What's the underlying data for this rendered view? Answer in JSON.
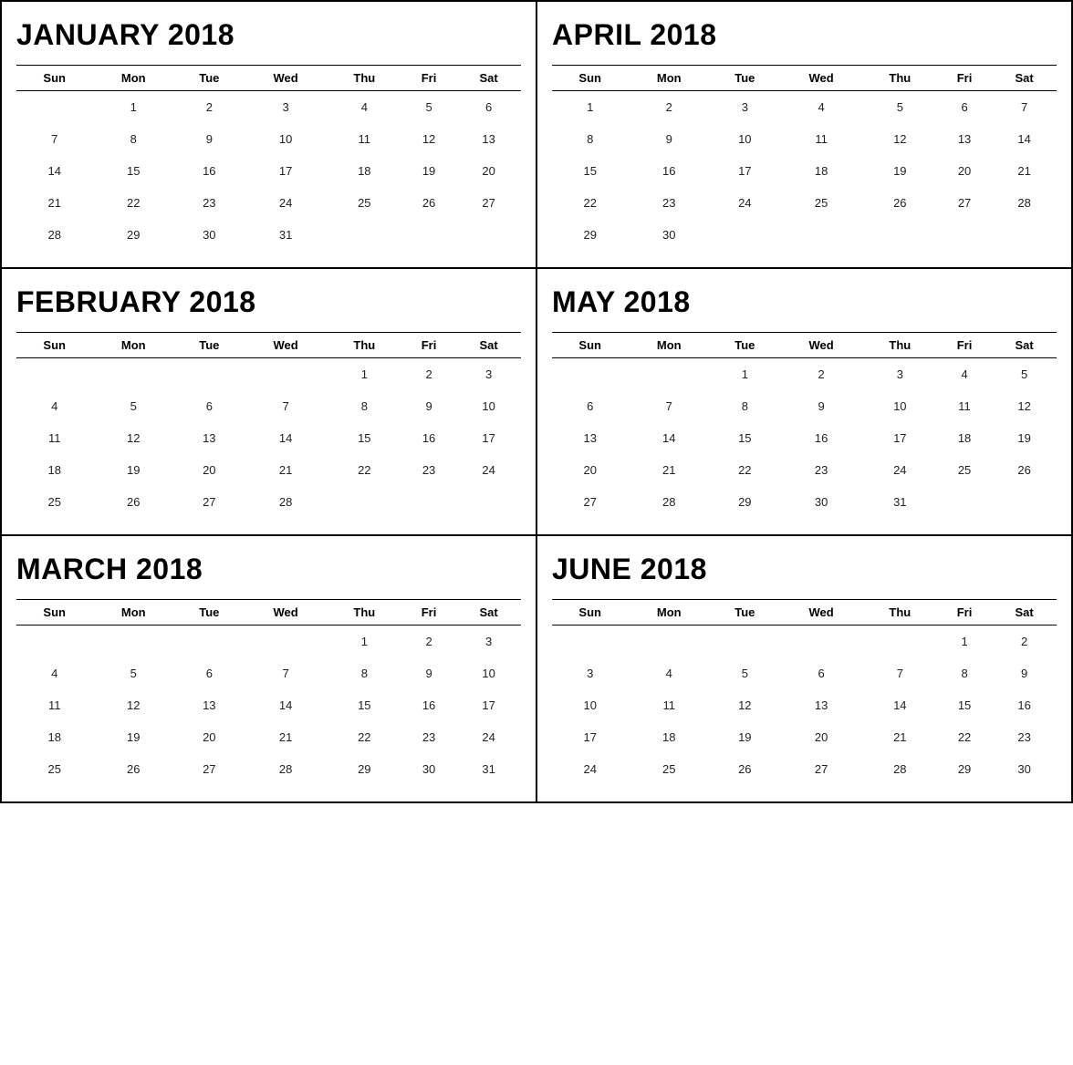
{
  "months": [
    {
      "id": "january-2018",
      "title": "JANUARY 2018",
      "days": [
        "Sun",
        "Mon",
        "Tue",
        "Wed",
        "Thu",
        "Fri",
        "Sat"
      ],
      "weeks": [
        [
          "",
          "1",
          "2",
          "3",
          "4",
          "5",
          "6"
        ],
        [
          "7",
          "8",
          "9",
          "10",
          "11",
          "12",
          "13"
        ],
        [
          "14",
          "15",
          "16",
          "17",
          "18",
          "19",
          "20"
        ],
        [
          "21",
          "22",
          "23",
          "24",
          "25",
          "26",
          "27"
        ],
        [
          "28",
          "29",
          "30",
          "31",
          "",
          "",
          ""
        ]
      ]
    },
    {
      "id": "april-2018",
      "title": "APRIL 2018",
      "days": [
        "Sun",
        "Mon",
        "Tue",
        "Wed",
        "Thu",
        "Fri",
        "Sat"
      ],
      "weeks": [
        [
          "1",
          "2",
          "3",
          "4",
          "5",
          "6",
          "7"
        ],
        [
          "8",
          "9",
          "10",
          "11",
          "12",
          "13",
          "14"
        ],
        [
          "15",
          "16",
          "17",
          "18",
          "19",
          "20",
          "21"
        ],
        [
          "22",
          "23",
          "24",
          "25",
          "26",
          "27",
          "28"
        ],
        [
          "29",
          "30",
          "",
          "",
          "",
          "",
          ""
        ]
      ]
    },
    {
      "id": "february-2018",
      "title": "FEBRUARY 2018",
      "days": [
        "Sun",
        "Mon",
        "Tue",
        "Wed",
        "Thu",
        "Fri",
        "Sat"
      ],
      "weeks": [
        [
          "",
          "",
          "",
          "",
          "1",
          "2",
          "3"
        ],
        [
          "4",
          "5",
          "6",
          "7",
          "8",
          "9",
          "10"
        ],
        [
          "11",
          "12",
          "13",
          "14",
          "15",
          "16",
          "17"
        ],
        [
          "18",
          "19",
          "20",
          "21",
          "22",
          "23",
          "24"
        ],
        [
          "25",
          "26",
          "27",
          "28",
          "",
          "",
          ""
        ]
      ]
    },
    {
      "id": "may-2018",
      "title": "MAY 2018",
      "days": [
        "Sun",
        "Mon",
        "Tue",
        "Wed",
        "Thu",
        "Fri",
        "Sat"
      ],
      "weeks": [
        [
          "",
          "",
          "1",
          "2",
          "3",
          "4",
          "5"
        ],
        [
          "6",
          "7",
          "8",
          "9",
          "10",
          "11",
          "12"
        ],
        [
          "13",
          "14",
          "15",
          "16",
          "17",
          "18",
          "19"
        ],
        [
          "20",
          "21",
          "22",
          "23",
          "24",
          "25",
          "26"
        ],
        [
          "27",
          "28",
          "29",
          "30",
          "31",
          "",
          ""
        ]
      ]
    },
    {
      "id": "march-2018",
      "title": "MARCH 2018",
      "days": [
        "Sun",
        "Mon",
        "Tue",
        "Wed",
        "Thu",
        "Fri",
        "Sat"
      ],
      "weeks": [
        [
          "",
          "",
          "",
          "",
          "1",
          "2",
          "3"
        ],
        [
          "4",
          "5",
          "6",
          "7",
          "8",
          "9",
          "10"
        ],
        [
          "11",
          "12",
          "13",
          "14",
          "15",
          "16",
          "17"
        ],
        [
          "18",
          "19",
          "20",
          "21",
          "22",
          "23",
          "24"
        ],
        [
          "25",
          "26",
          "27",
          "28",
          "29",
          "30",
          "31"
        ]
      ]
    },
    {
      "id": "june-2018",
      "title": "JUNE 2018",
      "days": [
        "Sun",
        "Mon",
        "Tue",
        "Wed",
        "Thu",
        "Fri",
        "Sat"
      ],
      "weeks": [
        [
          "",
          "",
          "",
          "",
          "",
          "1",
          "2"
        ],
        [
          "3",
          "4",
          "5",
          "6",
          "7",
          "8",
          "9"
        ],
        [
          "10",
          "11",
          "12",
          "13",
          "14",
          "15",
          "16"
        ],
        [
          "17",
          "18",
          "19",
          "20",
          "21",
          "22",
          "23"
        ],
        [
          "24",
          "25",
          "26",
          "27",
          "28",
          "29",
          "30"
        ]
      ]
    }
  ]
}
